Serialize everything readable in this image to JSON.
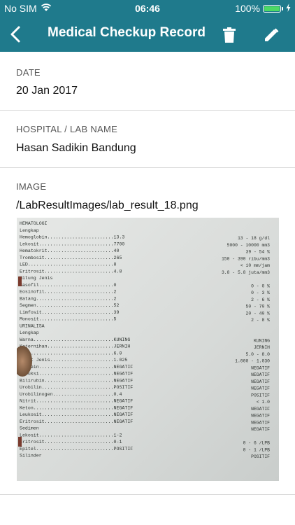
{
  "status_bar": {
    "carrier": "No SIM",
    "time": "06:46",
    "battery": "100%"
  },
  "nav": {
    "title": "Medical Checkup Record"
  },
  "fields": {
    "date_label": "DATE",
    "date_value": "20 Jan 2017",
    "hospital_label": "HOSPITAL / LAB NAME",
    "hospital_value": "Hasan Sadikin Bandung",
    "image_label": "IMAGE",
    "image_value": "/LabResultImages/lab_result_18.png"
  },
  "lab_sheet": {
    "lines": [
      {
        "t": "HEMATOLOGI",
        "r": ""
      },
      {
        "t": "   Lengkap",
        "r": ""
      },
      {
        "t": "      Hemoglobin........................13.3",
        "r": "13 - 18 g/dl"
      },
      {
        "t": "      Lekosit...........................7700",
        "r": "5000 - 10000 mm3"
      },
      {
        "t": "      Hematokrit........................40",
        "r": "39 - 54 %"
      },
      {
        "t": "      Trombosit.........................265",
        "r": "150 - 390 ribu/mm3"
      },
      {
        "t": "      LED...............................8",
        "r": "< 10 mm/jam"
      },
      {
        "t": "      Eritrosit.........................4.8",
        "r": "3.8 - 5.8 juta/mm3"
      },
      {
        "t": "   Hitung Jenis",
        "r": ""
      },
      {
        "t": "      Basofil...........................0",
        "r": "0 - 0 %"
      },
      {
        "t": "      Eosinofil.........................2",
        "r": "0 - 3 %"
      },
      {
        "t": "      Batang............................2",
        "r": "2 - 6 %"
      },
      {
        "t": "      Segmen............................52",
        "r": "50 - 70 %"
      },
      {
        "t": "      Limfosit..........................39",
        "r": "20 - 40 %"
      },
      {
        "t": "      Monosit...........................5",
        "r": "2 - 8 %"
      },
      {
        "t": "URINALISA",
        "r": ""
      },
      {
        "t": "   Lengkap",
        "r": ""
      },
      {
        "t": "      Warna.............................KUNING",
        "r": "KUNING"
      },
      {
        "t": "      Kejernihan........................JERNIH",
        "r": "JERNIH"
      },
      {
        "t": "      pH................................6.0",
        "r": "5.0 - 8.0"
      },
      {
        "t": "      Berat Jenis.......................1.025",
        "r": "1.000 - 1.030"
      },
      {
        "t": "      Protein...........................NEGATIF",
        "r": "NEGATIF"
      },
      {
        "t": "      Reduksi...........................NEGATIF",
        "r": "NEGATIF"
      },
      {
        "t": "      Bilirubin.........................NEGATIF",
        "r": "NEGATIF"
      },
      {
        "t": "      Urobilin..........................POSITIF",
        "r": "NEGATIF"
      },
      {
        "t": "      Urobilinogen......................0.4",
        "r": "POSITIF"
      },
      {
        "t": "      Nitrit............................NEGATIF",
        "r": "< 1.0"
      },
      {
        "t": "      Keton.............................NEGATIF",
        "r": "NEGATIF"
      },
      {
        "t": "      Leukosit..........................NEGATIF",
        "r": "NEGATIF"
      },
      {
        "t": "      Eritrosit.........................NEGATIF",
        "r": "NEGATIF"
      },
      {
        "t": "   Sedimen",
        "r": "NEGATIF"
      },
      {
        "t": "      Lekosit...........................1-2",
        "r": ""
      },
      {
        "t": "      Eritrosit.........................0-1",
        "r": "0 - 6 /LPB"
      },
      {
        "t": "      Epitel............................POSITIF",
        "r": "0 - 1 /LPB"
      },
      {
        "t": "      Silinder",
        "r": "POSITIF"
      }
    ]
  }
}
